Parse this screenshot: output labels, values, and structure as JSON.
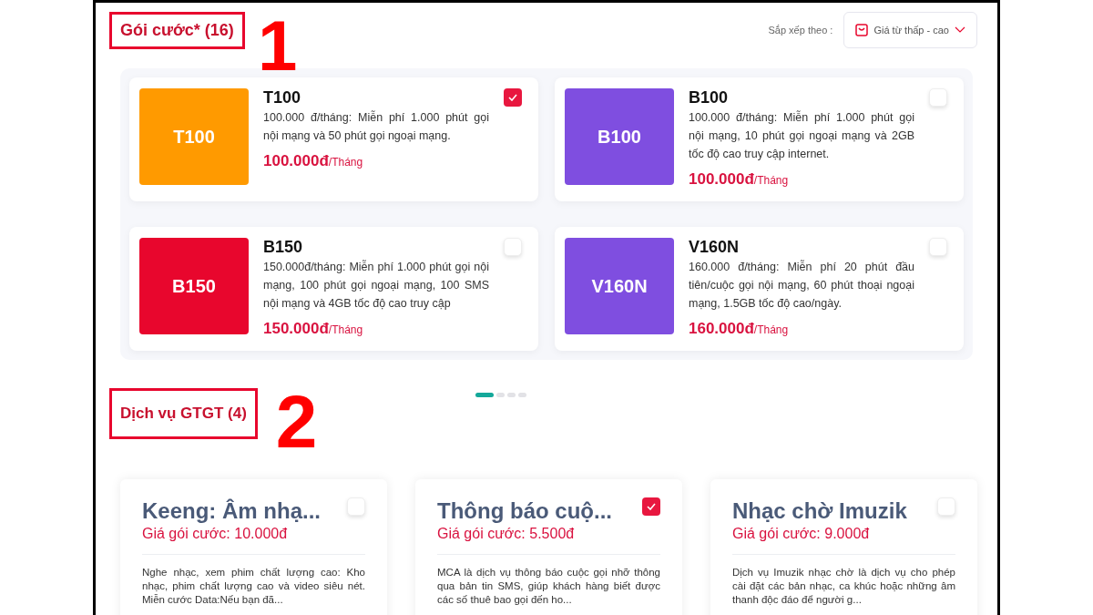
{
  "packages": {
    "heading": "Gói cước* (16)",
    "marker": "1",
    "sort_label": "Sắp xếp theo :",
    "sort_value": "Giá từ thấp - cao",
    "items": [
      {
        "code": "T100",
        "name": "T100",
        "description": "100.000 đ/tháng: Miễn phí 1.000 phút gọi nội mạng và 50 phút gọi ngoại mạng.",
        "price": "100.000đ",
        "unit": "/Tháng",
        "color": "#ff9a00",
        "checked": true
      },
      {
        "code": "B100",
        "name": "B100",
        "description": "100.000 đ/tháng: Miễn phí 1.000 phút gọi nội mạng, 10 phút gọi ngoại mạng và 2GB tốc độ cao truy cập internet.",
        "price": "100.000đ",
        "unit": "/Tháng",
        "color": "#7f4ee0",
        "checked": false
      },
      {
        "code": "B150",
        "name": "B150",
        "description": "150.000đ/tháng: Miễn phí 1.000 phút gọi nội mạng, 100 phút gọi ngoại mạng, 100 SMS nội mạng và 4GB tốc độ cao truy cập",
        "price": "150.000đ",
        "unit": "/Tháng",
        "color": "#e8062d",
        "checked": false
      },
      {
        "code": "V160N",
        "name": "V160N",
        "description": "160.000 đ/tháng: Miễn phí 20 phút đầu tiên/cuộc gọi nội mạng, 60 phút thoại ngoại mạng, 1.5GB tốc độ cao/ngày.",
        "price": "160.000đ",
        "unit": "/Tháng",
        "color": "#7f4ee0",
        "checked": false
      }
    ],
    "pager": [
      {
        "selected": true
      },
      {
        "selected": false
      },
      {
        "selected": false
      },
      {
        "selected": false
      }
    ]
  },
  "services": {
    "heading": "Dịch vụ GTGT (4)",
    "marker": "2",
    "items": [
      {
        "name": "Keeng: Âm nhạ...",
        "price": "Giá gói cước: 10.000đ",
        "description": "Nghe nhạc, xem phim chất lượng cao: Kho nhạc, phim chất lượng cao và video siêu nét. Miễn cước Data:Nếu bạn đã...",
        "checked": false
      },
      {
        "name": "Thông báo cuộ...",
        "price": "Giá gói cước: 5.500đ",
        "description": "MCA là dịch vụ thông báo cuộc gọi nhỡ thông qua bản tin SMS, giúp khách hàng biết được các số thuê bao gọi đến ho...",
        "checked": true
      },
      {
        "name": "Nhạc chờ Imuzik",
        "price": "Giá gói cước: 9.000đ",
        "description": "Dịch vụ Imuzik nhạc chờ là dịch vụ cho phép cài đặt các bản nhạc, ca khúc hoặc những âm thanh độc đáo để người g...",
        "checked": false
      }
    ]
  }
}
